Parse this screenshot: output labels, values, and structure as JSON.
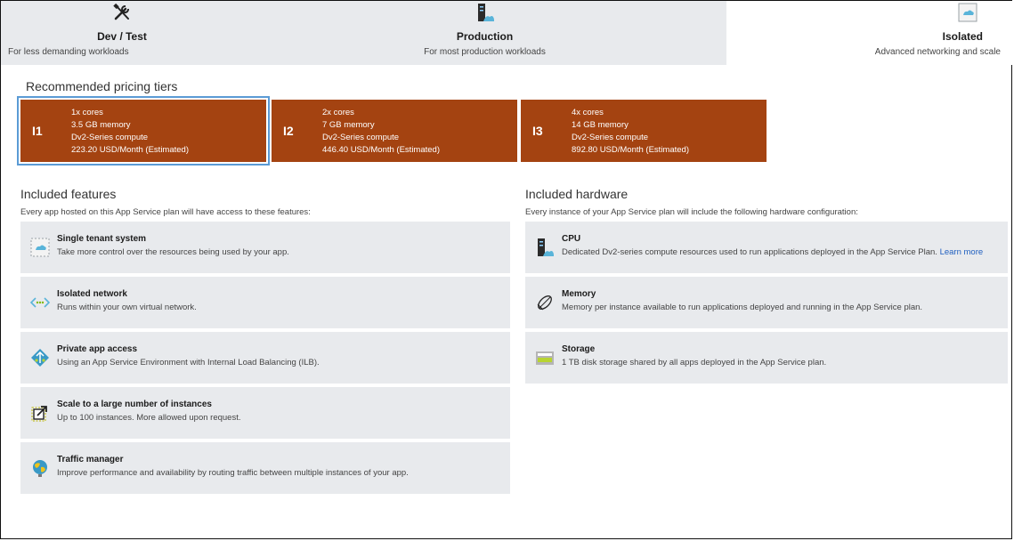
{
  "tabs": [
    {
      "name": "Dev / Test",
      "desc": "For less demanding workloads",
      "icon": "tools-icon"
    },
    {
      "name": "Production",
      "desc": "For most production workloads",
      "icon": "server-icon"
    },
    {
      "name": "Isolated",
      "desc": "Advanced networking and scale",
      "icon": "isolated-icon"
    }
  ],
  "pricing": {
    "title": "Recommended pricing tiers",
    "tiers": [
      {
        "code": "I1",
        "cores": "1x cores",
        "memory": "3.5 GB memory",
        "compute": "Dv2-Series compute",
        "price": "223.20 USD/Month (Estimated)"
      },
      {
        "code": "I2",
        "cores": "2x cores",
        "memory": "7 GB memory",
        "compute": "Dv2-Series compute",
        "price": "446.40 USD/Month (Estimated)"
      },
      {
        "code": "I3",
        "cores": "4x cores",
        "memory": "14 GB memory",
        "compute": "Dv2-Series compute",
        "price": "892.80 USD/Month (Estimated)"
      }
    ]
  },
  "features": {
    "title": "Included features",
    "subtitle": "Every app hosted on this App Service plan will have access to these features:",
    "items": [
      {
        "title": "Single tenant system",
        "desc": "Take more control over the resources being used by your app."
      },
      {
        "title": "Isolated network",
        "desc": "Runs within your own virtual network."
      },
      {
        "title": "Private app access",
        "desc": "Using an App Service Environment with Internal Load Balancing (ILB)."
      },
      {
        "title": "Scale to a large number of instances",
        "desc": "Up to 100 instances. More allowed upon request."
      },
      {
        "title": "Traffic manager",
        "desc": "Improve performance and availability by routing traffic between multiple instances of your app."
      }
    ]
  },
  "hardware": {
    "title": "Included hardware",
    "subtitle": "Every instance of your App Service plan will include the following hardware configuration:",
    "items": [
      {
        "title": "CPU",
        "desc": "Dedicated Dv2-series compute resources used to run applications deployed in the App Service Plan.",
        "link": "Learn more"
      },
      {
        "title": "Memory",
        "desc": "Memory per instance available to run applications deployed and running in the App Service plan."
      },
      {
        "title": "Storage",
        "desc": "1 TB disk storage shared by all apps deployed in the App Service plan."
      }
    ]
  },
  "colors": {
    "tier_bg": "#a44311",
    "selected_outline": "#5b9bd5",
    "card_bg": "#e8eaed",
    "link": "#1f5fbf"
  }
}
